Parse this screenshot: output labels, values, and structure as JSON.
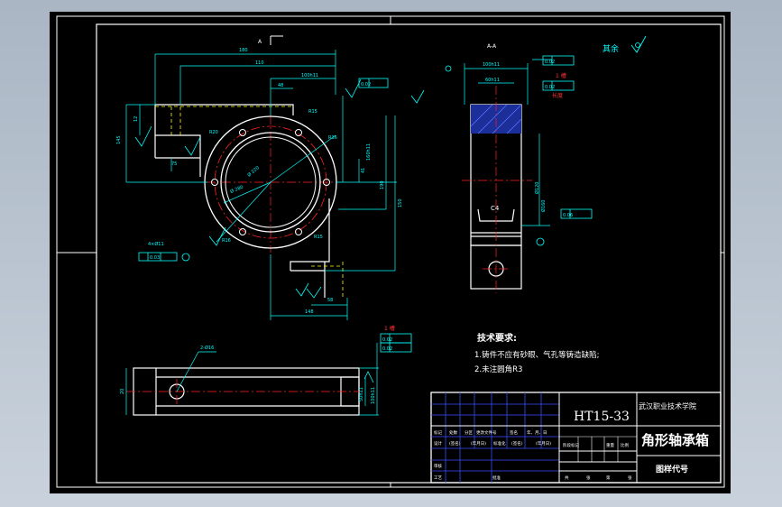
{
  "drawing": {
    "part_number": "HT15-33",
    "school": "武汉职业技术学院",
    "part_name": "角形轴承箱",
    "drawing_code_label": "图样代号",
    "roughness_note": "其余",
    "section_label": "A-A",
    "view_label": "A"
  },
  "tech_req": {
    "title": "技术要求:",
    "items": [
      "1.铸件不应有砂眼、气孔等铸造缺陷;",
      "2.未注圆角R3"
    ]
  },
  "title_block": {
    "row_labels_1": [
      "标记",
      "处数",
      "分区",
      "更改文件号",
      "签名",
      "年、月、日"
    ],
    "row_labels_2": [
      "设计",
      "(签名)",
      "(年月日)",
      "标准化",
      "(签名)",
      "(年月日)"
    ],
    "stage_labels": [
      "阶段标记",
      "重量",
      "比例"
    ],
    "review_labels": [
      "审核"
    ],
    "craft_labels": [
      "工艺"
    ],
    "approve_label": "批准",
    "sheet_labels": [
      "共",
      "张",
      "第",
      "张"
    ]
  },
  "dimensions": {
    "top_view": [
      "180",
      "110",
      "100h11",
      "48",
      "R15",
      "R20",
      "R16",
      "Ø 220",
      "Ø 280",
      "Ø 312",
      "190",
      "150",
      "160h11",
      "41",
      "R15",
      "58",
      "148",
      "75",
      "145",
      "12",
      "4×Ø11"
    ],
    "section_view": [
      "100h11",
      "60h11",
      "C4",
      "Ø120",
      "Ø160",
      "Ø0.06"
    ],
    "bottom_view": [
      "2-Ø16",
      "50h11",
      "100h11",
      "20"
    ],
    "gdt": [
      "0.02",
      "0.03",
      "1 槽",
      "长度"
    ]
  },
  "colors": {
    "background": "#000000",
    "line": "#ffffff",
    "dim": "#00ffff",
    "center": "#ff2020",
    "hidden": "#ffff00",
    "hatch": "#3050ff",
    "table_blue": "#3a4dff"
  }
}
